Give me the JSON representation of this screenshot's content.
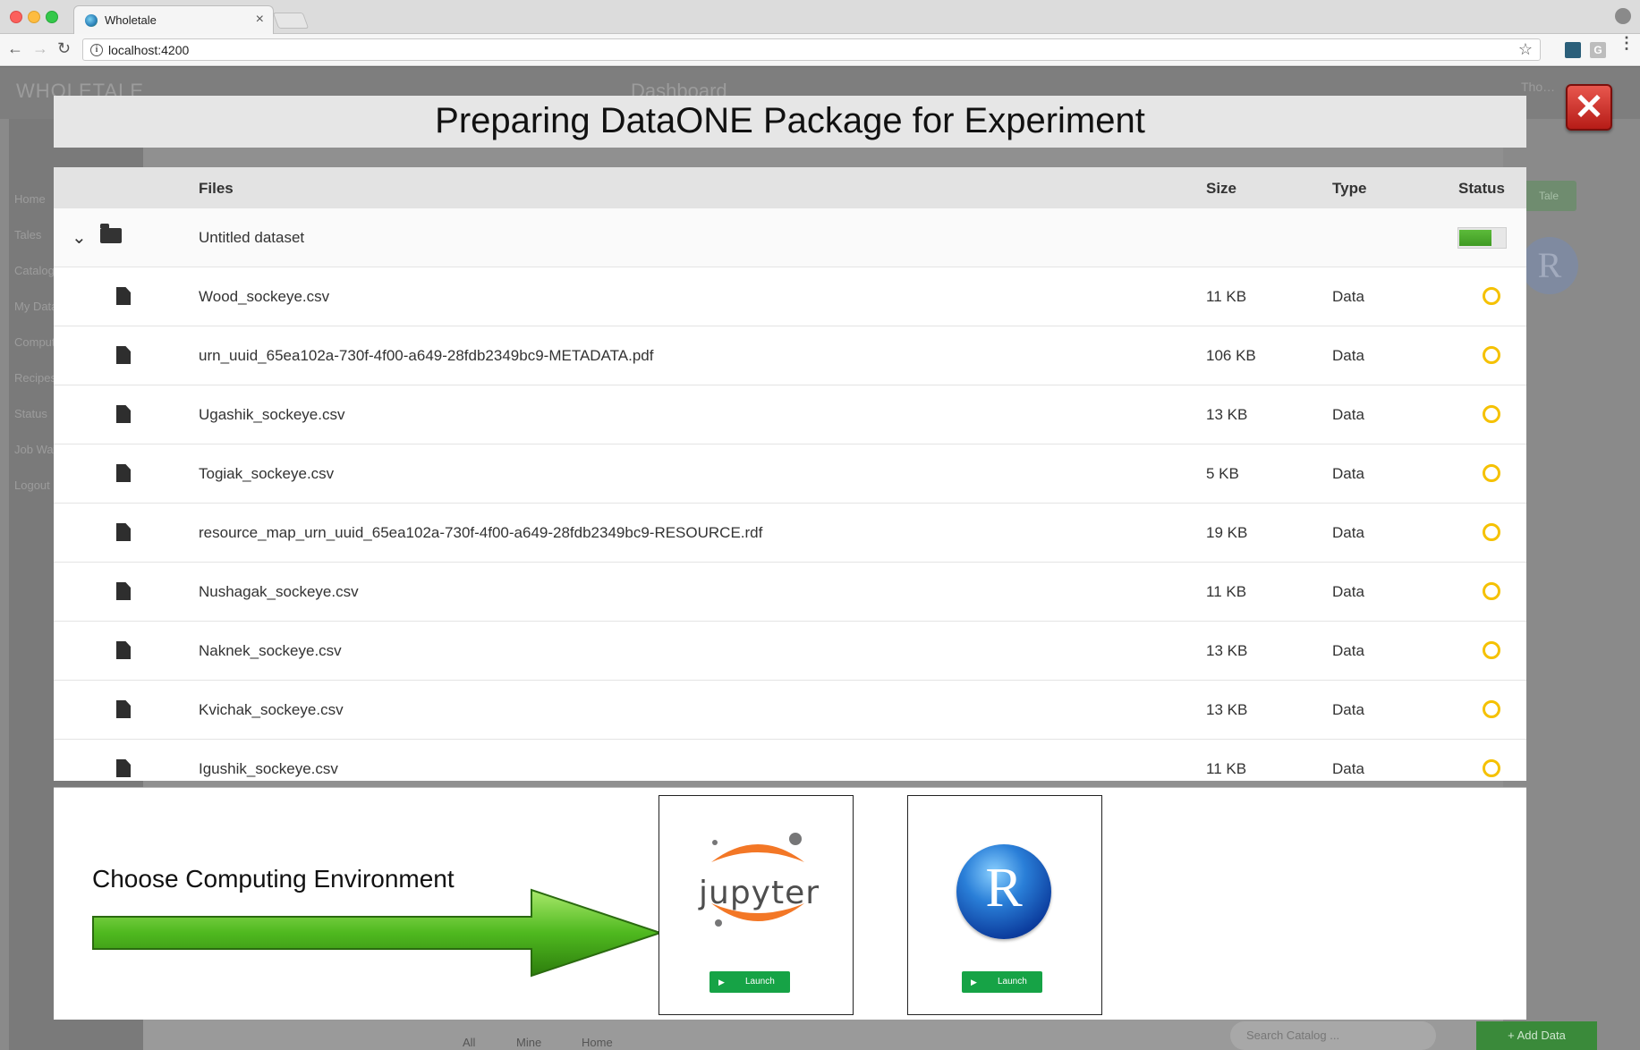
{
  "browser": {
    "tab_title": "Wholetale",
    "tab_close": "×",
    "url": "localhost:4200",
    "info_glyph": "i",
    "star_glyph": "☆",
    "ext_label": "G",
    "menu_glyph": "⋮",
    "back_glyph": "←",
    "forward_glyph": "→",
    "reload_glyph": "↻"
  },
  "background_app": {
    "logo": "WHOLETALE",
    "page_title": "Dashboard",
    "user": "Tho…",
    "sidebar": [
      "Home",
      "Tales",
      "Catalog",
      "My Data",
      "Compute",
      "Recipes",
      "Status",
      "Job Watch",
      "Logout"
    ],
    "new_tale_button": "Tale",
    "r_letter": "R",
    "bottom_tabs": [
      "All",
      "Mine",
      "Home"
    ],
    "search_placeholder": "Search Catalog ...",
    "add_data_button": "+ Add Data"
  },
  "modal": {
    "title": "Preparing DataONE Package for Experiment",
    "close_glyph": "✕",
    "columns": {
      "files": "Files",
      "size": "Size",
      "type": "Type",
      "status": "Status"
    },
    "folder": {
      "name": "Untitled dataset",
      "chevron": "⌄",
      "progress": 0.7
    },
    "files": [
      {
        "name": "Wood_sockeye.csv",
        "size": "11 KB",
        "type": "Data"
      },
      {
        "name": "urn_uuid_65ea102a-730f-4f00-a649-28fdb2349bc9-METADATA.pdf",
        "size": "106 KB",
        "type": "Data"
      },
      {
        "name": "Ugashik_sockeye.csv",
        "size": "13 KB",
        "type": "Data"
      },
      {
        "name": "Togiak_sockeye.csv",
        "size": "5 KB",
        "type": "Data"
      },
      {
        "name": "resource_map_urn_uuid_65ea102a-730f-4f00-a649-28fdb2349bc9-RESOURCE.rdf",
        "size": "19 KB",
        "type": "Data"
      },
      {
        "name": "Nushagak_sockeye.csv",
        "size": "11 KB",
        "type": "Data"
      },
      {
        "name": "Naknek_sockeye.csv",
        "size": "13 KB",
        "type": "Data"
      },
      {
        "name": "Kvichak_sockeye.csv",
        "size": "13 KB",
        "type": "Data"
      },
      {
        "name": "Igushik_sockeye.csv",
        "size": "11 KB",
        "type": "Data"
      }
    ],
    "environment": {
      "label": "Choose Computing Environment",
      "jupyter": {
        "logo_text": "jupyter",
        "launch": "Launch",
        "play": "▶"
      },
      "rstudio": {
        "logo_letter": "R",
        "launch": "Launch",
        "play": "▶"
      }
    }
  },
  "colors": {
    "status_pending": "#f5c100",
    "launch_green": "#16a346",
    "close_red": "#c9302c"
  }
}
